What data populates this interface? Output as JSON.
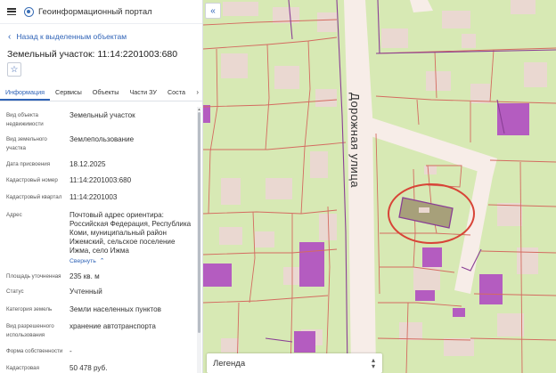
{
  "app": {
    "title": "Геоинформационный портал"
  },
  "nav": {
    "back_label": "Назад к выделенным объектам"
  },
  "object": {
    "title": "Земельный участок: 11:14:2201003:680"
  },
  "tabs": [
    {
      "label": "Информация",
      "active": true
    },
    {
      "label": "Сервисы",
      "active": false
    },
    {
      "label": "Объекты",
      "active": false
    },
    {
      "label": "Части ЗУ",
      "active": false
    },
    {
      "label": "Соста",
      "active": false
    }
  ],
  "props": [
    {
      "label": "Вид объекта недвижимости",
      "value": "Земельный участок"
    },
    {
      "label": "Вид земельного участка",
      "value": "Землепользование"
    },
    {
      "label": "Дата присвоения",
      "value": "18.12.2025"
    },
    {
      "label": "Кадастровый номер",
      "value": "11:14:2201003:680"
    },
    {
      "label": "Кадастровый квартал",
      "value": "11:14:2201003"
    },
    {
      "label": "Адрес",
      "value": "Почтовый адрес ориентира: Российская Федерация, Республика Коми, муниципальный район Ижемский, сельское поселение Ижма, село Ижма",
      "link": "Свернуть"
    },
    {
      "label": "Площадь уточненная",
      "value": "235 кв. м"
    },
    {
      "label": "Статус",
      "value": "Учтенный"
    },
    {
      "label": "Категория земель",
      "value": "Земли населенных пунктов"
    },
    {
      "label": "Вид разрешенного использования",
      "value": "хранение автотранспорта"
    },
    {
      "label": "Форма собственности",
      "value": "-"
    },
    {
      "label": "Кадастровая",
      "value": "50 478 руб."
    }
  ],
  "map": {
    "street_name": "Дорожная улица",
    "legend_label": "Легенда",
    "colors": {
      "map_bg": "#d7e9b4",
      "road": "#f7ede8",
      "building": "#ead8d1",
      "parcel_line": "#d46b60",
      "boundary_line": "#8a3f95",
      "building_fill": "#b45cc0",
      "selection": "#d84437"
    }
  },
  "icons": {
    "menu": "menu-icon",
    "logo": "portal-logo-icon",
    "back": "chevron-left-icon",
    "favorite": "star-icon",
    "tabs_next": "chevron-right-icon",
    "collapse_panel": "double-chevron-left-icon",
    "legend_toggle": "chevron-up-down-icon"
  }
}
